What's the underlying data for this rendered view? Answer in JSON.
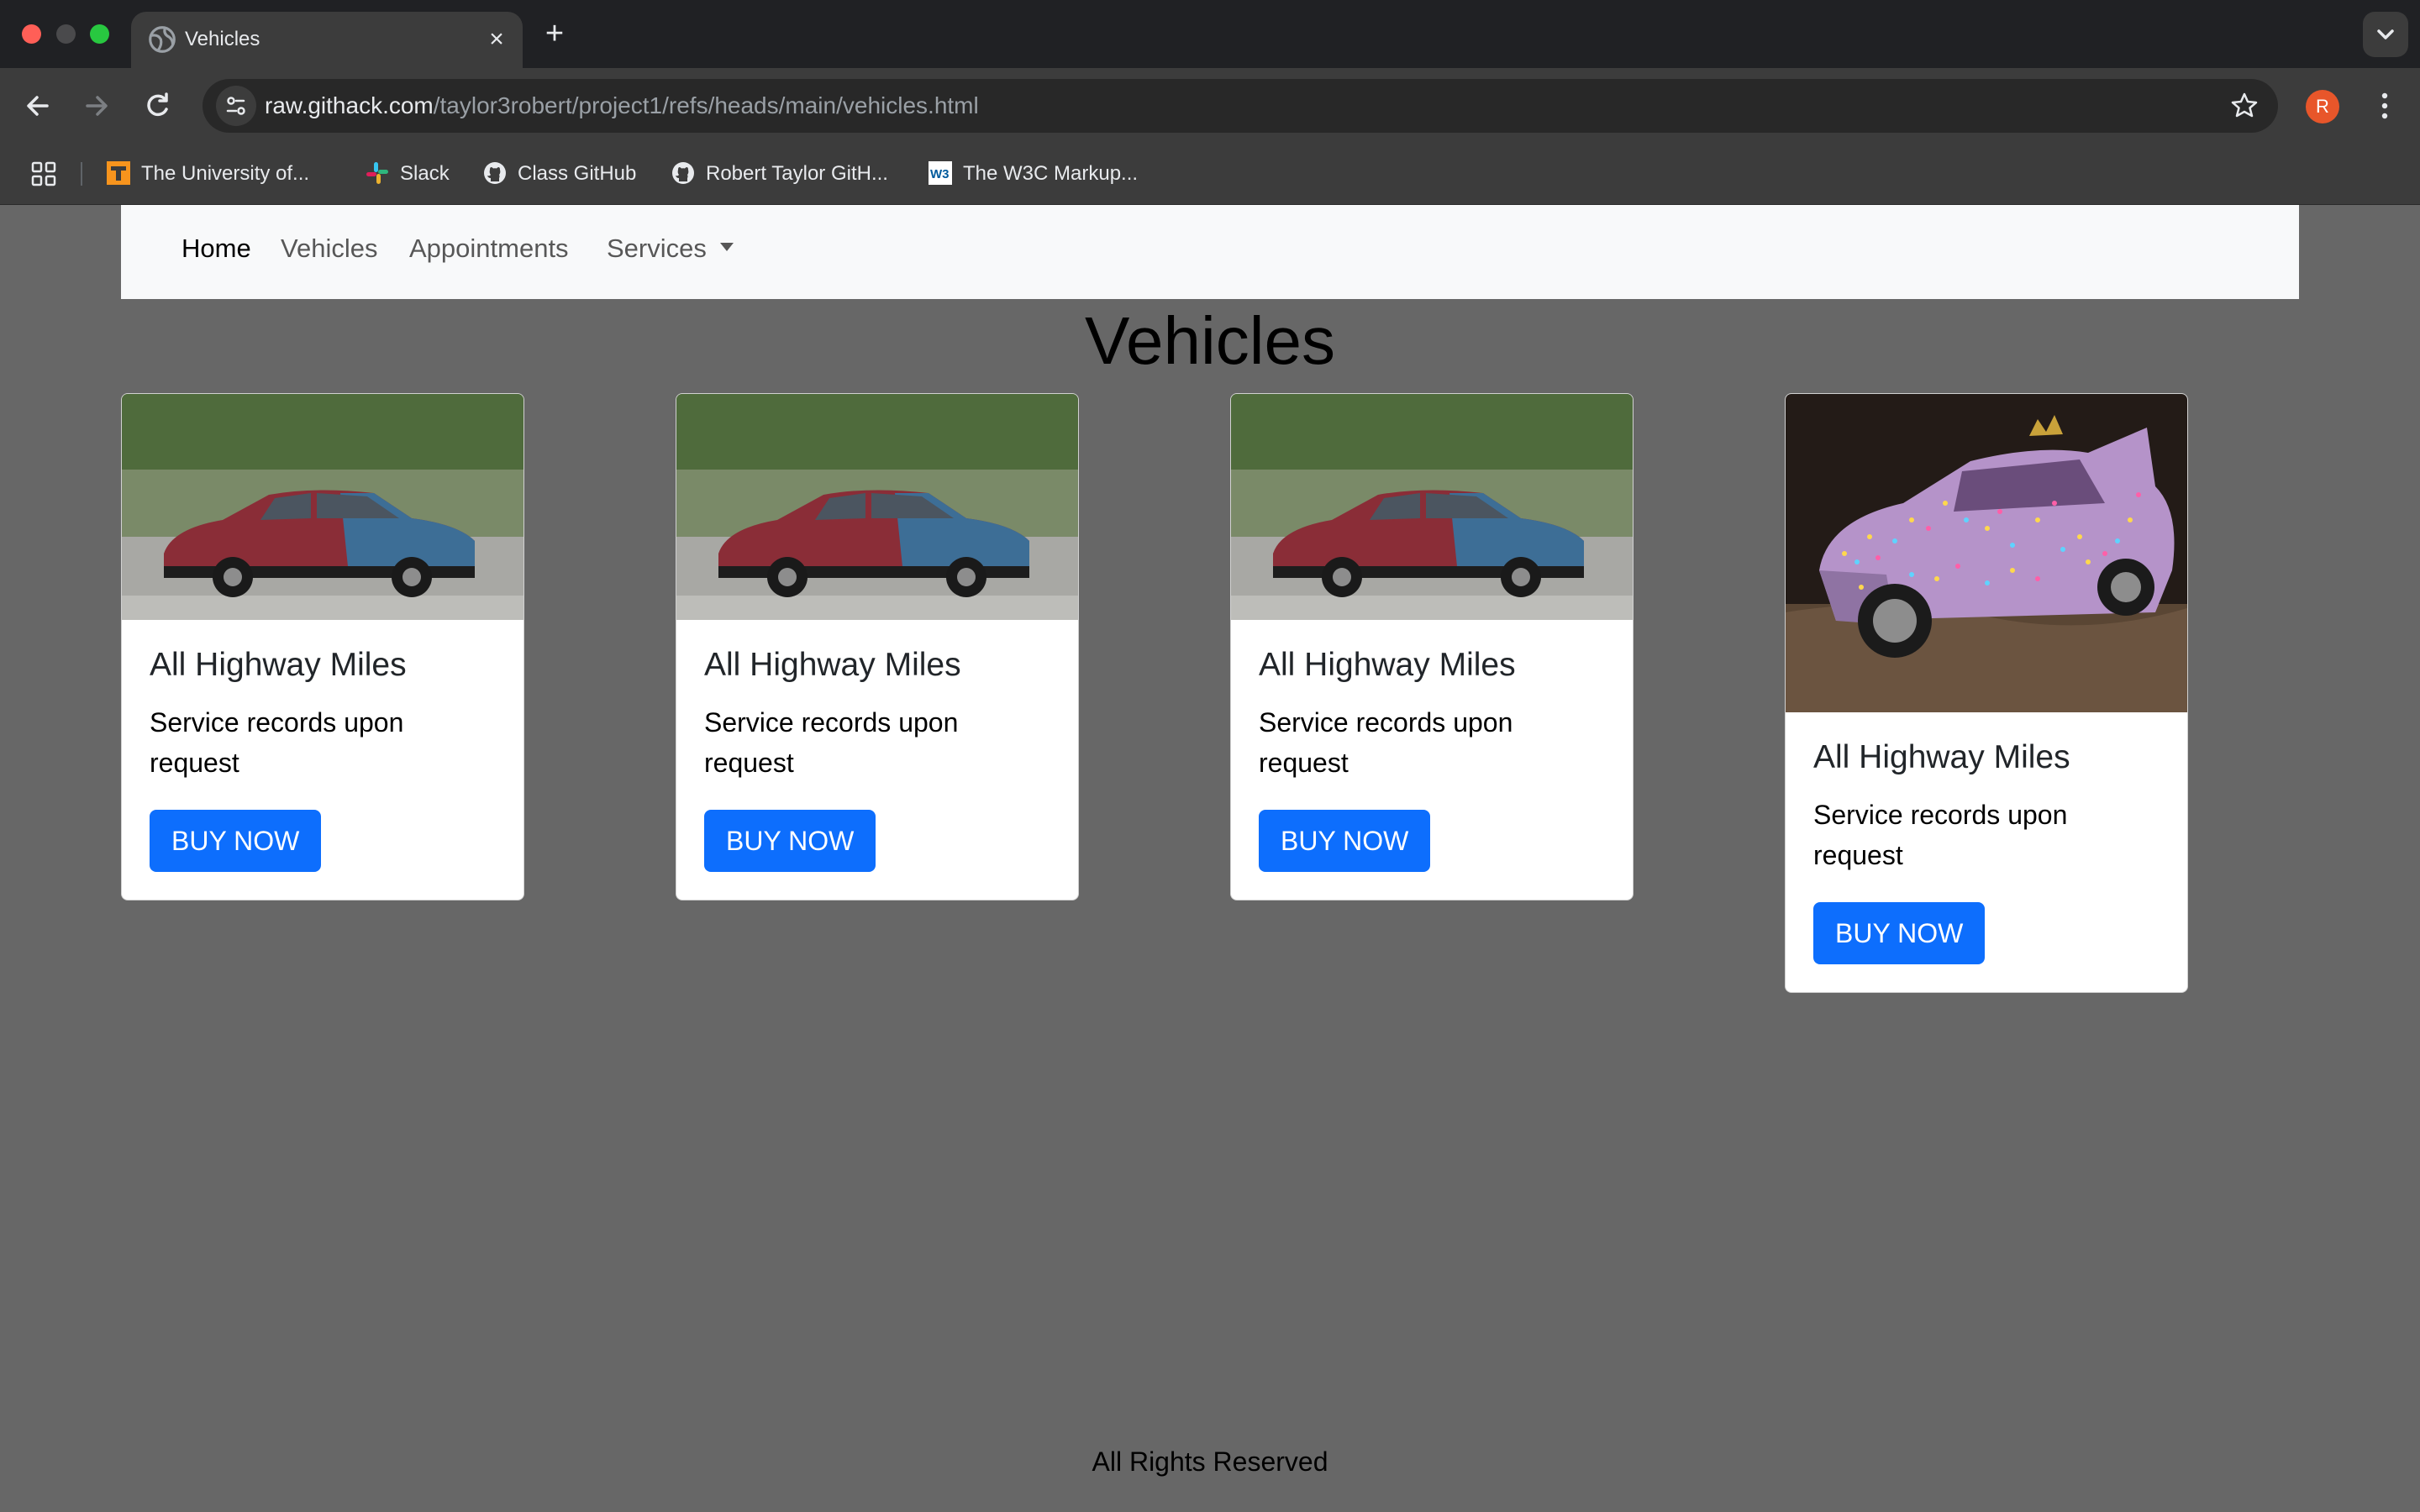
{
  "browser": {
    "tab_title": "Vehicles",
    "new_tab_label": "+",
    "url_host": "raw.githack.com",
    "url_path": "/taylor3robert/project1/refs/heads/main/vehicles.html",
    "profile_initial": "R",
    "bookmarks": [
      {
        "label": "The University of...",
        "icon": "university-t-icon"
      },
      {
        "label": "Slack",
        "icon": "slack-icon"
      },
      {
        "label": "Class GitHub",
        "icon": "github-icon"
      },
      {
        "label": "Robert Taylor GitH...",
        "icon": "github-icon"
      },
      {
        "label": "The W3C Markup...",
        "icon": "w3c-icon"
      }
    ]
  },
  "navbar": {
    "items": [
      {
        "label": "Home",
        "active": true
      },
      {
        "label": "Vehicles",
        "active": false
      },
      {
        "label": "Appointments",
        "active": false
      },
      {
        "label": "Services",
        "active": false,
        "dropdown": true
      }
    ]
  },
  "page": {
    "title": "Vehicles",
    "footer": "All Rights Reserved"
  },
  "cards": [
    {
      "image": "red-blue-sedan-photo",
      "title": "All Highway Miles",
      "text": "Service records upon request",
      "button": "BUY NOW"
    },
    {
      "image": "red-blue-sedan-photo",
      "title": "All Highway Miles",
      "text": "Service records upon request",
      "button": "BUY NOW"
    },
    {
      "image": "red-blue-sedan-photo",
      "title": "All Highway Miles",
      "text": "Service records upon request",
      "button": "BUY NOW"
    },
    {
      "image": "christmas-lights-car-photo",
      "title": "All Highway Miles",
      "text": "Service records upon request",
      "button": "BUY NOW"
    }
  ],
  "colors": {
    "page_background": "#676767",
    "navbar_background": "#f8f9fa",
    "button_primary": "#0d6efd"
  }
}
